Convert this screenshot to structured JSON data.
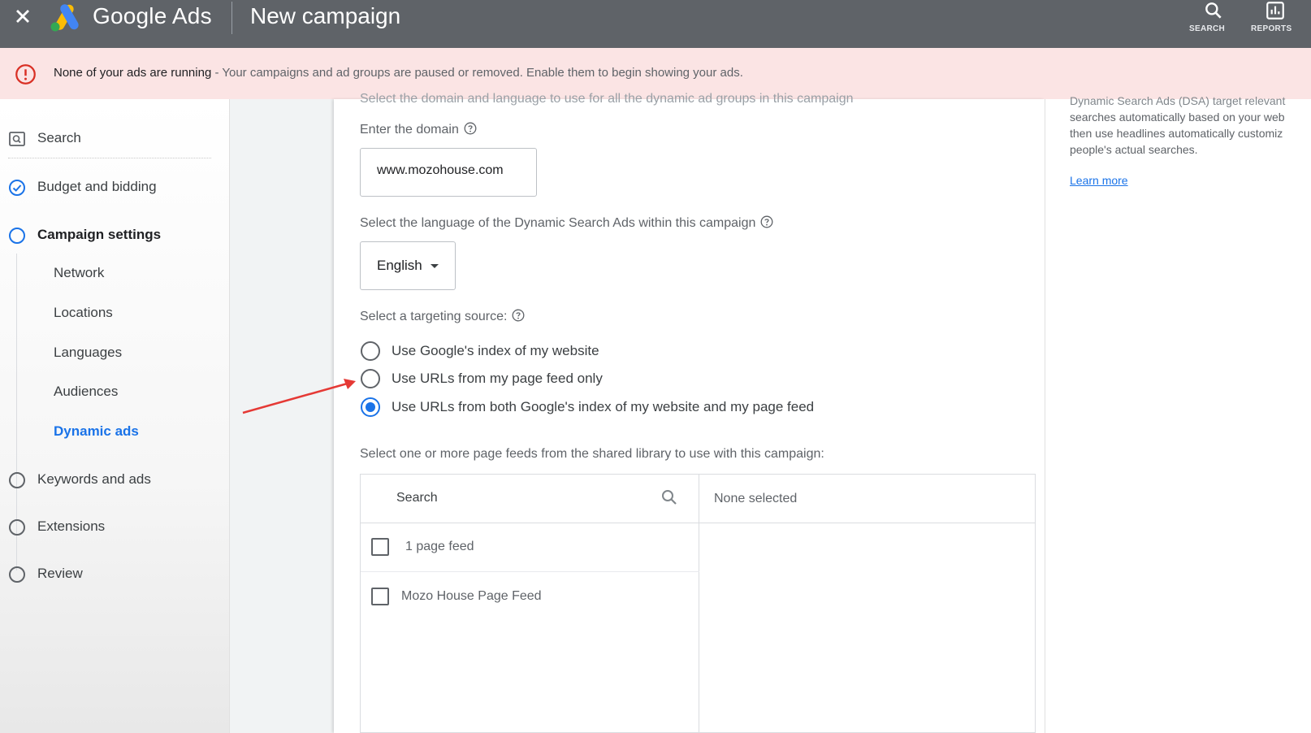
{
  "header": {
    "brand": "Google Ads",
    "page_title": "New campaign",
    "tools": [
      {
        "label": "SEARCH",
        "icon": "search-icon"
      },
      {
        "label": "REPORTS",
        "icon": "reports-icon"
      }
    ],
    "background": "#5f6368"
  },
  "alert": {
    "title": "None of your ads are running",
    "message": "- Your campaigns and ad groups are paused or removed. Enable them to begin showing your ads.",
    "background": "#fbe4e4",
    "icon_color": "#d93025"
  },
  "sidebar": {
    "steps": [
      {
        "label": "Search",
        "icon": "search-box-icon",
        "state": "icon"
      },
      {
        "label": "Budget and bidding",
        "icon": "check-circle-icon",
        "state": "done"
      },
      {
        "label": "Campaign settings",
        "icon": "circle-icon",
        "state": "current"
      },
      {
        "label": "Keywords and ads",
        "icon": "circle-icon",
        "state": "todo"
      },
      {
        "label": "Extensions",
        "icon": "circle-icon",
        "state": "todo"
      },
      {
        "label": "Review",
        "icon": "circle-icon",
        "state": "todo"
      }
    ],
    "substeps": [
      {
        "label": "Network"
      },
      {
        "label": "Locations"
      },
      {
        "label": "Languages"
      },
      {
        "label": "Audiences"
      },
      {
        "label": "Dynamic ads",
        "active": true
      }
    ]
  },
  "form": {
    "intro_partial": "Select the domain and language to use for all the dynamic ad groups in this campaign",
    "domain_label": "Enter the domain",
    "domain_value": "www.mozohouse.com",
    "language_label": "Select the language of the Dynamic Search Ads within this campaign",
    "language_value": "English",
    "targeting_label": "Select a targeting source:",
    "targeting_options": [
      {
        "label": "Use Google's index of my website",
        "selected": false
      },
      {
        "label": "Use URLs from my page feed only",
        "selected": false
      },
      {
        "label": "Use URLs from both Google's index of my website and my page feed",
        "selected": true
      }
    ],
    "feeds_label": "Select one or more page feeds from the shared library to use with this campaign:",
    "feed_search_placeholder": "Search",
    "feeds": [
      {
        "label": "1 page feed",
        "checked": false
      },
      {
        "label": "Mozo House Page Feed",
        "checked": false
      }
    ],
    "selected_placeholder": "None selected"
  },
  "help_panel": {
    "lines": [
      "Dynamic Search Ads (DSA) target relevant",
      "searches automatically based on your web",
      "then use headlines automatically customiz",
      "people's actual searches."
    ],
    "learn_more": "Learn more"
  },
  "colors": {
    "accent": "#1a73e8",
    "annotation_arrow": "#e53935"
  }
}
